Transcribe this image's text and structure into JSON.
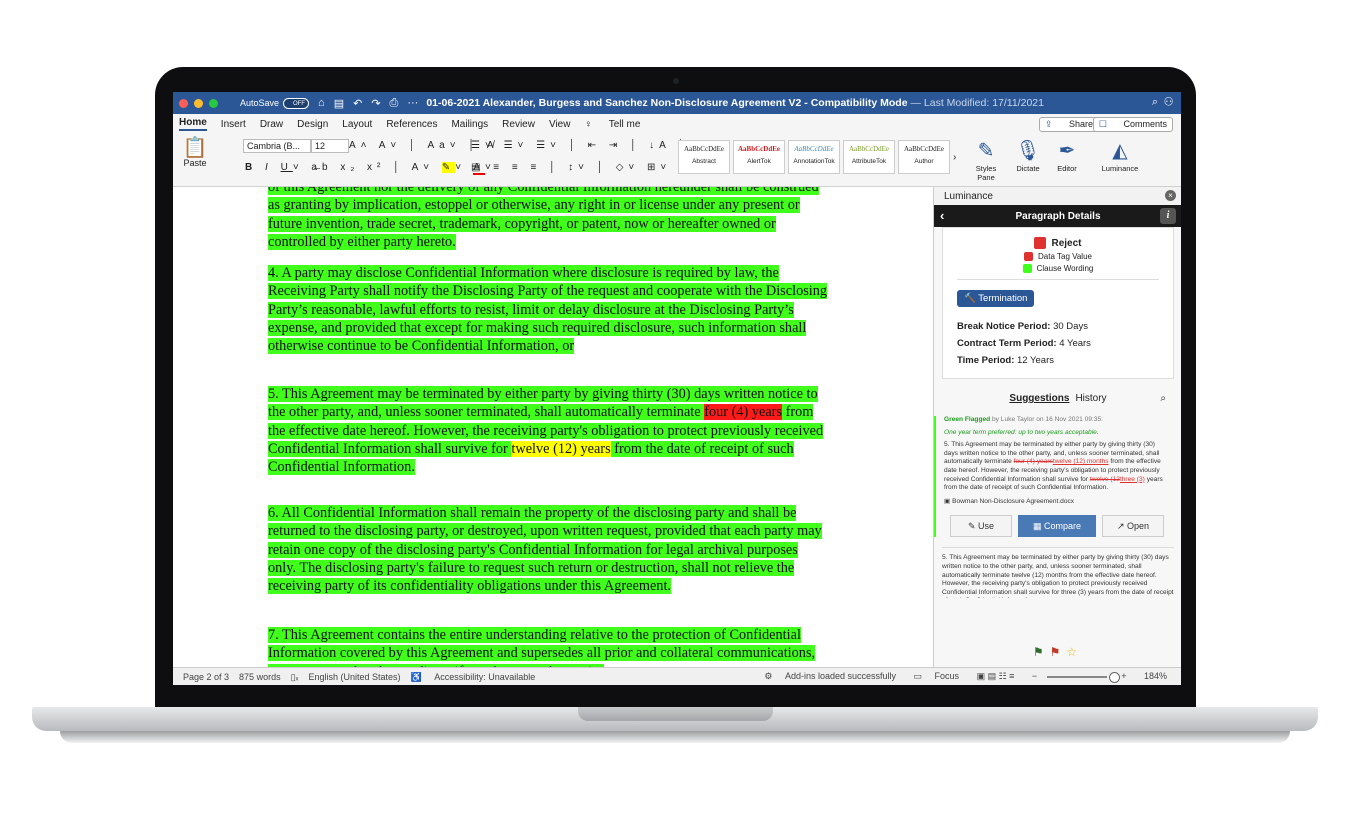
{
  "window": {
    "autosave_label": "AutoSave",
    "autosave_state": "OFF",
    "doc_title": "01-06-2021 Alexander, Burgess and Sanchez Non-Disclosure Agreement V2",
    "doc_suffix": " - Compatibility Mode",
    "last_modified": "— Last Modified: 17/11/2021"
  },
  "menu": {
    "tabs": [
      "Home",
      "Insert",
      "Draw",
      "Design",
      "Layout",
      "References",
      "Mailings",
      "Review",
      "View"
    ],
    "tell_me": "Tell me",
    "share": "Share",
    "comments": "Comments"
  },
  "ribbon": {
    "paste": "Paste",
    "font_name": "Cambria (B...",
    "font_size": "12",
    "styles": [
      {
        "sample": "AaBbCcDdEe",
        "name": "Abstract",
        "color": "#222222"
      },
      {
        "sample": "AaBbCcDdEe",
        "name": "AlertTok",
        "color": "#d11a1a"
      },
      {
        "sample": "AaBbCcDdEe",
        "name": "AnnotationTok",
        "color": "#3d8bb8"
      },
      {
        "sample": "AaBbCcDdEe",
        "name": "AttributeTok",
        "color": "#7a9b2a"
      },
      {
        "sample": "AaBbCcDdEe",
        "name": "Author",
        "color": "#222222"
      }
    ],
    "styles_pane": "Styles Pane",
    "dictate": "Dictate",
    "editor": "Editor",
    "luminance": "Luminance"
  },
  "document": {
    "p3_tail": "of this Agreement nor the delivery of any Confidential Information hereunder shall be construed as granting by implication, estoppel or otherwise, any right in or license under any present or future invention, trade secret, trademark, copyright, or patent, now or hereafter owned or controlled by either party hereto.",
    "p4": "4. A party may disclose Confidential Information where disclosure is required by law, the Receiving Party shall notify the Disclosing Party of the request and cooperate with the Disclosing Party’s reasonable, lawful efforts to resist, limit or delay disclosure at the Disclosing Party’s expense, and provided that except for making such required disclosure, such information shall otherwise continue to be Confidential Information, or",
    "p5_a": "5. This Agreement may be terminated by either party by giving thirty (30) days written notice to the other party, and, unless sooner terminated, shall automatically terminate ",
    "p5_red": "four (4) years",
    "p5_b": " from the effective date hereof. However, the receiving party's obligation to protect previously received Confidential Information shall survive for ",
    "p5_yellow": "twelve (12) years",
    "p5_c": " from the date of receipt of such Confidential Information.",
    "p6": "6. All Confidential Information shall remain the property of the disclosing party and shall be returned to the disclosing party, or destroyed, upon written request, provided that each party may retain one copy of the disclosing party's Confidential Information for legal archival purposes only. The disclosing party's failure to request such return or destruction, shall not relieve the receiving party of its confidentiality obligations under this Agreement.",
    "p7": "7. This Agreement contains the entire understanding relative to the protection of Confidential Information covered by this Agreement and supersedes all prior and collateral communications, agreements and understandings, if any, between the parties"
  },
  "pane": {
    "title": "Luminance",
    "header": "Paragraph Details",
    "legend_reject": "Reject",
    "legend_data_tag": "Data Tag Value",
    "legend_clause": "Clause Wording",
    "tag": "Termination",
    "fields": [
      {
        "label": "Break Notice Period:",
        "value": "30 Days"
      },
      {
        "label": "Contract Term Period:",
        "value": "4 Years"
      },
      {
        "label": "Time Period:",
        "value": "12 Years"
      }
    ],
    "tab_suggestions": "Suggestions",
    "tab_history": "History",
    "flag_label": "Green Flagged",
    "flag_by": "by Luke Taylor on 16 Nov 2021 09:35:",
    "flag_note": "One year term preferred: up to two years acceptable.",
    "sugg_a": "5. This Agreement may be terminated by either party by giving thirty (30) days written notice to the other party, and, unless sooner terminated, shall automatically terminate ",
    "sugg_del1": "four (4) years",
    "sugg_ins1": "twelve (12) months",
    "sugg_b": " from the effective date hereof. However, the receiving party's obligation to protect previously received Confidential Information shall survive for ",
    "sugg_del2": "twelve (12",
    "sugg_ins2": "three (3)",
    "sugg_c": " years from the date of receipt of such Confidential Information.",
    "source_doc": "Bowman Non-Disclosure Agreement.docx",
    "btn_use": "Use",
    "btn_compare": "Compare",
    "btn_open": "Open",
    "sugg2": "5. This Agreement may be terminated by either party by giving thirty (30) days written notice to the other party, and, unless sooner terminated, shall automatically terminate twelve (12) months from the effective date hereof. However, the receiving party's obligation to protect previously received Confidential Information shall survive for three (3) years from the date of receipt of such Confidential Information."
  },
  "status": {
    "page": "Page 2 of 3",
    "words": "875 words",
    "language": "English (United States)",
    "accessibility": "Accessibility: Unavailable",
    "addins": "Add-ins loaded successfully",
    "focus": "Focus",
    "zoom": "184%"
  },
  "colors": {
    "clause": "#40ff1a",
    "reject": "#e03131",
    "data_tag": "#e03131",
    "accent": "#2b5797"
  }
}
